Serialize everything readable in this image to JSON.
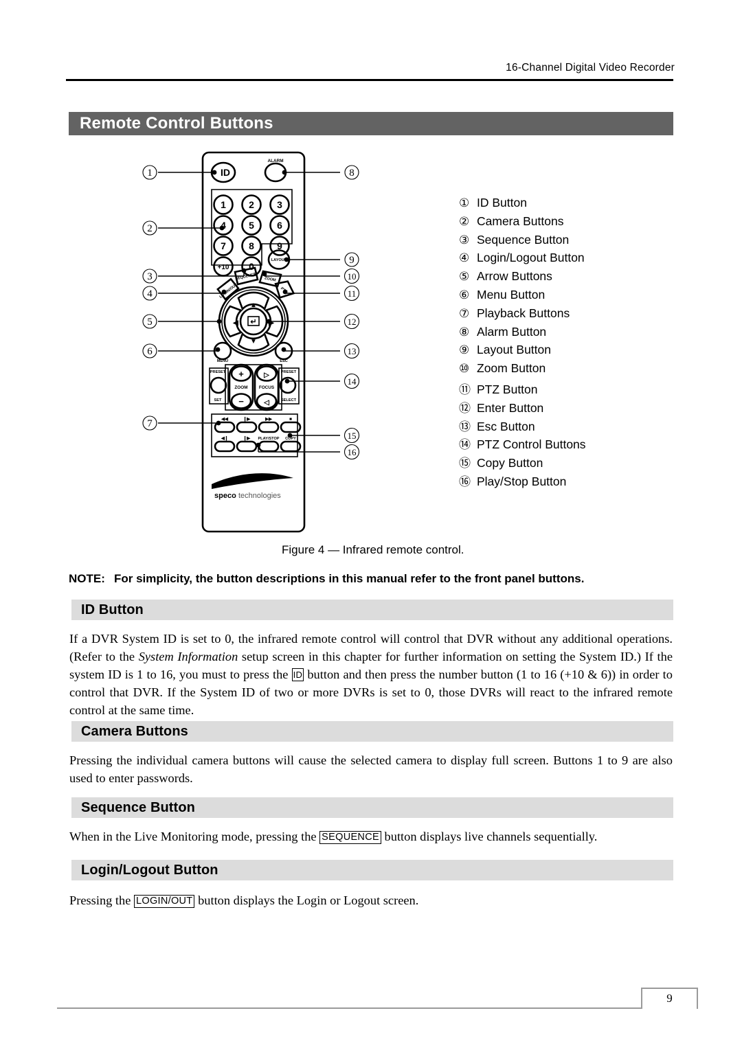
{
  "header": {
    "running_title": "16-Channel Digital Video Recorder"
  },
  "section_banner": {
    "title": "Remote Control Buttons"
  },
  "figure": {
    "caption": "Figure 4 — Infrared remote control.",
    "brand_bold": "speco",
    "brand_light": "technologies",
    "remote_labels": {
      "id": "ID",
      "alarm": "ALARM",
      "layout": "LAYOUT",
      "sequence": "SEQUENCE",
      "zoom_top": "ZOOM",
      "login_out": "LOGIN/OUT",
      "ptz": "PTZ",
      "menu": "MENU",
      "esc": "ESC",
      "preset_set_1": "PRESET",
      "preset_set_2": "SET",
      "preset_select_1": "PRESET",
      "preset_select_2": "SELECT",
      "zoom": "ZOOM",
      "focus": "FOCUS",
      "play_stop": "PLAY/STOP",
      "copy": "COPY",
      "plus": "+",
      "minus": "−"
    },
    "keypad": [
      "1",
      "2",
      "3",
      "4",
      "5",
      "6",
      "7",
      "8",
      "9",
      "+10",
      "0"
    ],
    "callouts_left": [
      "1",
      "2",
      "3",
      "4",
      "5",
      "6",
      "7"
    ],
    "callouts_right": [
      "8",
      "9",
      "10",
      "11",
      "12",
      "13",
      "14",
      "15",
      "16"
    ]
  },
  "legend": {
    "items": [
      {
        "num": "①",
        "label": "ID Button"
      },
      {
        "num": "②",
        "label": "Camera Buttons"
      },
      {
        "num": "③",
        "label": "Sequence Button"
      },
      {
        "num": "④",
        "label": "Login/Logout Button"
      },
      {
        "num": "⑤",
        "label": "Arrow Buttons"
      },
      {
        "num": "⑥",
        "label": "Menu Button"
      },
      {
        "num": "⑦",
        "label": "Playback Buttons"
      },
      {
        "num": "⑧",
        "label": "Alarm Button"
      },
      {
        "num": "⑨",
        "label": "Layout Button"
      },
      {
        "num": "⑩",
        "label": "Zoom Button"
      },
      {
        "num": "⑪",
        "label": "PTZ Button"
      },
      {
        "num": "⑫",
        "label": "Enter Button"
      },
      {
        "num": "⑬",
        "label": "Esc Button"
      },
      {
        "num": "⑭",
        "label": "PTZ Control Buttons"
      },
      {
        "num": "⑮",
        "label": "Copy Button"
      },
      {
        "num": "⑯",
        "label": "Play/Stop Button"
      }
    ]
  },
  "note": {
    "label": "NOTE:",
    "text": "For simplicity, the button descriptions in this manual refer to the front panel buttons."
  },
  "sections": [
    {
      "heading": "ID Button",
      "paragraph_part1": "If a DVR System ID is set to 0, the infrared remote control will control that DVR without any additional operations. (Refer to the ",
      "paragraph_italic": "System Information",
      "paragraph_part2": " setup screen in this chapter for further information on setting the System ID.)  If the system ID is 1 to 16, you must to press the ",
      "keycap": "ID",
      "paragraph_part3": " button and then press the number button (1 to 16 (+10 & 6)) in order to control that DVR.  If the System ID of two or more DVRs is set to 0, those DVRs will react to the infrared remote control at the same time."
    },
    {
      "heading": "Camera Buttons",
      "paragraph_part1": "Pressing the individual camera buttons will cause the selected camera to display full screen.  Buttons 1 to 9 are also used to enter passwords."
    },
    {
      "heading": "Sequence Button",
      "paragraph_part1": "When in the Live Monitoring mode, pressing the ",
      "keycap": "SEQUENCE",
      "paragraph_part2": " button displays live channels sequentially."
    },
    {
      "heading": "Login/Logout Button",
      "paragraph_part1": "Pressing the ",
      "keycap": "LOGIN/OUT",
      "paragraph_part2": " button displays the Login or Logout screen."
    }
  ],
  "footer": {
    "page_number": "9"
  },
  "colors": {
    "banner_dark": "#636363",
    "banner_light": "#dcdcdc",
    "rule": "#000000",
    "footer_rule": "#9a9a9a"
  }
}
